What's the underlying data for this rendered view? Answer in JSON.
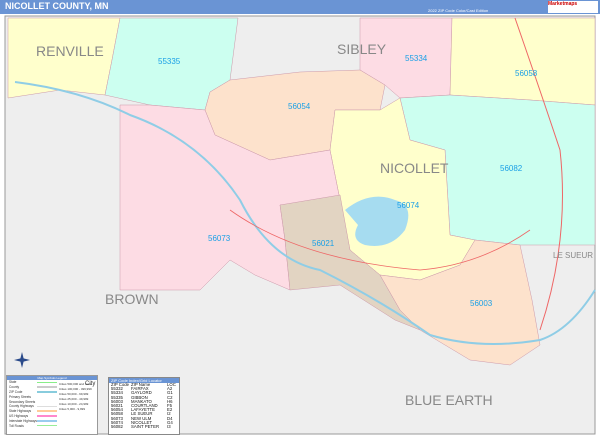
{
  "header": {
    "title": "NICOLLET COUNTY, MN",
    "edition": "2022 ZIP Code Color/Cast Edition",
    "logo": "Marketmaps"
  },
  "counties": [
    "RENVILLE",
    "SIBLEY",
    "NICOLLET",
    "LE SUEUR",
    "BROWN",
    "BLUE EARTH"
  ],
  "zip_labels": [
    "55335",
    "55334",
    "56058",
    "56054",
    "56082",
    "56074",
    "56073",
    "56021",
    "56003"
  ],
  "colors": {
    "header": "#6a94d4",
    "yellow": "#ffffcc",
    "mint": "#ccfff0",
    "pink": "#fddce4",
    "peach": "#fde2cc",
    "tan": "#e2d4c2",
    "gray": "#eeeeee",
    "water": "#a6dcf0",
    "zip_text": "#1aa0e6"
  },
  "legend": {
    "title": "Map Symbols Legend",
    "items": [
      "State",
      "County",
      "ZIP Code",
      "Primary Streets",
      "Secondary Streets",
      "County Highways",
      "State Highways",
      "US Highways",
      "Interstate Highways",
      "Toll Roads"
    ],
    "cities": [
      "Cities 500,000 and more",
      "Cities 100,000 - 499,999",
      "Cities 50,000 - 99,999",
      "Cities 25,000 - 49,999",
      "Cities 10,000 - 24,999",
      "Cities 5,000 - 9,999"
    ],
    "city_sample": "City"
  },
  "zip_index": {
    "title": "ZIP Code Index/Grid Locator",
    "headers": [
      "ZIP Code",
      "ZIP Name",
      "LOC"
    ],
    "rows": [
      [
        "55332",
        "FAIRFAX",
        "A2"
      ],
      [
        "55334",
        "GAYLORD",
        "G1"
      ],
      [
        "55335",
        "GIBBON",
        "C2"
      ],
      [
        "56003",
        "MANKATO",
        "H6"
      ],
      [
        "56021",
        "COURTLAND",
        "F5"
      ],
      [
        "56054",
        "LAFAYETTE",
        "E2"
      ],
      [
        "56058",
        "LE SUEUR",
        "I2"
      ],
      [
        "56073",
        "NEW ULM",
        "D4"
      ],
      [
        "56074",
        "NICOLLET",
        "G4"
      ],
      [
        "56082",
        "SAINT PETER",
        "I3"
      ]
    ]
  }
}
